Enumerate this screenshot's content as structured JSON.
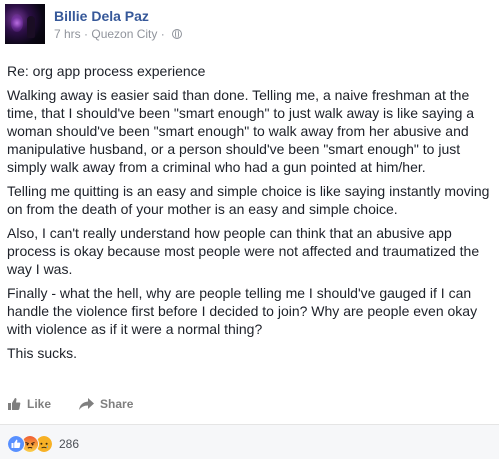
{
  "post": {
    "author": "Billie Dela Paz",
    "time": "7 hrs",
    "location": "Quezon City",
    "separator_1": " · ",
    "separator_2": " · ",
    "paragraphs": [
      "Re: org app process experience",
      "Walking away is easier said than done. Telling me, a naive freshman at the time, that I should've been \"smart enough\" to just walk away is like saying a woman should've been \"smart enough\" to walk away from her abusive and manipulative husband, or a person should've been \"smart enough\" to just simply walk away from a criminal who had a gun pointed at him/her.",
      "Telling me quitting is an easy and simple choice is like saying instantly moving on from the death of your mother is an easy and simple choice.",
      "Also, I can't really understand how people can think that an abusive app process is okay because most people were not affected and traumatized the way I was.",
      "Finally - what the hell, why are people telling me I should've gauged if I can handle the violence first before I decided to join? Why are people even okay with violence as if it were a normal thing?",
      "This sucks."
    ]
  },
  "actions": {
    "like_label": "Like",
    "share_label": "Share"
  },
  "reactions": {
    "types": [
      "like-reaction-icon",
      "angry-reaction-icon",
      "sad-reaction-icon"
    ],
    "count": "286"
  },
  "colors": {
    "name": "#365899",
    "meta": "#90949c",
    "like_blue": "#5890ff",
    "angry": "#f15c34",
    "sad": "#f7b125"
  }
}
